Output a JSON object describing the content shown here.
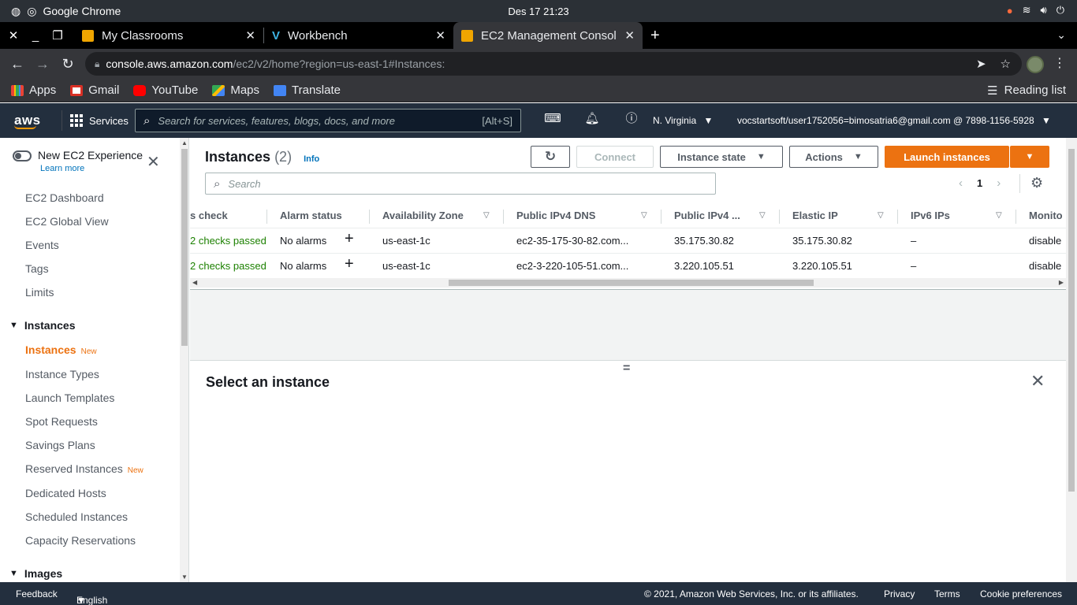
{
  "os": {
    "app_name": "Google Chrome",
    "clock": "Des 17  21:23"
  },
  "tabs": [
    {
      "title": "My Classrooms"
    },
    {
      "title": "Workbench"
    },
    {
      "title": "EC2 Management Console"
    }
  ],
  "address": {
    "host": "console.aws.amazon.com",
    "path": "/ec2/v2/home?region=us-east-1#Instances:"
  },
  "bookmarks": [
    {
      "label": "Apps",
      "color": "#ea4335"
    },
    {
      "label": "Gmail",
      "color": "#d93025"
    },
    {
      "label": "YouTube",
      "color": "#ff0000"
    },
    {
      "label": "Maps",
      "color": "#34a853"
    },
    {
      "label": "Translate",
      "color": "#4285f4"
    }
  ],
  "reading_list": "Reading list",
  "aws": {
    "logo": "aws",
    "services": "Services",
    "search_placeholder": "Search for services, features, blogs, docs, and more",
    "search_shortcut": "[Alt+S]",
    "region": "N. Virginia",
    "account": "vocstartsoft/user1752056=bimosatria6@gmail.com @ 7898-1156-5928"
  },
  "sidenav": {
    "toggle_label": "New EC2 Experience",
    "learn_more": "Learn more",
    "top_items": [
      "EC2 Dashboard",
      "EC2 Global View",
      "Events",
      "Tags",
      "Limits"
    ],
    "section_instances": "Instances",
    "instances_items": [
      {
        "label": "Instances",
        "badge": "New",
        "active": true
      },
      {
        "label": "Instance Types",
        "badge": "",
        "active": false
      },
      {
        "label": "Launch Templates",
        "badge": "",
        "active": false
      },
      {
        "label": "Spot Requests",
        "badge": "",
        "active": false
      },
      {
        "label": "Savings Plans",
        "badge": "",
        "active": false
      },
      {
        "label": "Reserved Instances",
        "badge": "New",
        "active": false
      },
      {
        "label": "Dedicated Hosts",
        "badge": "",
        "active": false
      },
      {
        "label": "Scheduled Instances",
        "badge": "",
        "active": false
      },
      {
        "label": "Capacity Reservations",
        "badge": "",
        "active": false
      }
    ],
    "section_images": "Images"
  },
  "main": {
    "title": "Instances",
    "count": "(2)",
    "info": "Info",
    "connect": "Connect",
    "instance_state": "Instance state",
    "actions": "Actions",
    "launch": "Launch instances",
    "search_placeholder": "Search",
    "page": "1",
    "columns": [
      "s check",
      "Alarm status",
      "Availability Zone",
      "Public IPv4 DNS",
      "Public IPv4 ...",
      "Elastic IP",
      "IPv6 IPs",
      "Monito"
    ],
    "rows": [
      {
        "status_check": "2 checks passed",
        "alarm": "No alarms",
        "az": "us-east-1c",
        "dns": "ec2-35-175-30-82.com...",
        "ipv4": "35.175.30.82",
        "eip": "35.175.30.82",
        "ipv6": "–",
        "monitoring": "disable"
      },
      {
        "status_check": "2 checks passed",
        "alarm": "No alarms",
        "az": "us-east-1c",
        "dns": "ec2-3-220-105-51.com...",
        "ipv4": "3.220.105.51",
        "eip": "3.220.105.51",
        "ipv6": "–",
        "monitoring": "disable"
      }
    ],
    "details_title": "Select an instance"
  },
  "footer": {
    "feedback": "Feedback",
    "language": "English (US)",
    "copyright": "© 2021, Amazon Web Services, Inc. or its affiliates.",
    "privacy": "Privacy",
    "terms": "Terms",
    "cookies": "Cookie preferences"
  }
}
